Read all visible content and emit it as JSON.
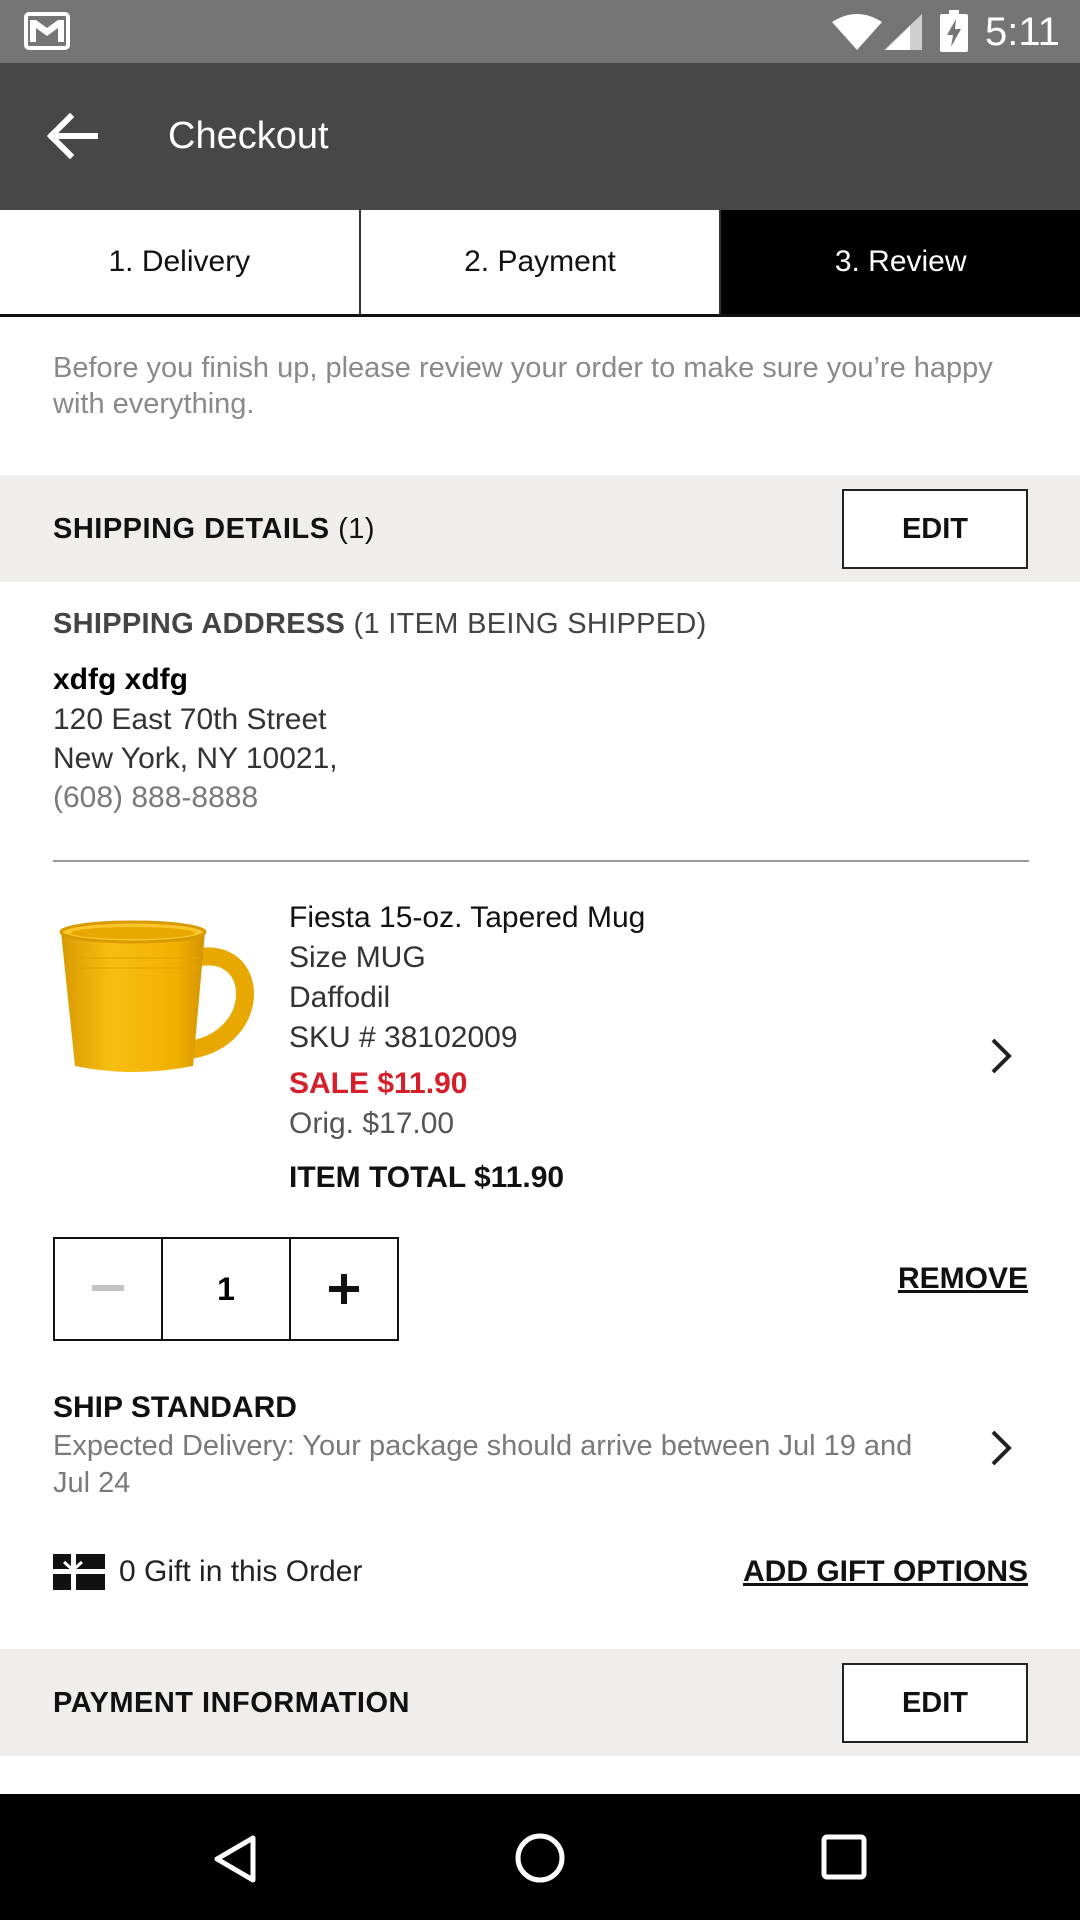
{
  "status_bar": {
    "time": "5:11"
  },
  "app_bar": {
    "title": "Checkout"
  },
  "tabs": [
    {
      "label": "1. Delivery"
    },
    {
      "label": "2. Payment"
    },
    {
      "label": "3. Review"
    }
  ],
  "intro_text": "Before you finish up, please review your order to make sure you’re happy with everything.",
  "shipping_details": {
    "title": "SHIPPING DETAILS",
    "count": "(1)",
    "edit_label": "EDIT"
  },
  "shipping_address": {
    "heading": "SHIPPING ADDRESS",
    "heading_note": "(1 ITEM BEING SHIPPED)",
    "name": "xdfg xdfg",
    "street": "120 East 70th Street",
    "city_line": "New York, NY 10021,",
    "phone": "(608) 888-8888"
  },
  "product": {
    "name": "Fiesta 15-oz. Tapered Mug",
    "size": "Size MUG",
    "color": "Daffodil",
    "sku": "SKU # 38102009",
    "sale_price": "SALE $11.90",
    "orig_price": "Orig. $17.00",
    "item_total": "ITEM TOTAL $11.90",
    "quantity": "1",
    "remove_label": "REMOVE"
  },
  "shipping_method": {
    "title": "SHIP STANDARD",
    "description": "Expected Delivery: Your package should arrive between Jul 19 and Jul 24"
  },
  "gift": {
    "count_text": "0 Gift in this Order",
    "add_label": "ADD GIFT OPTIONS"
  },
  "payment_information": {
    "title": "PAYMENT INFORMATION",
    "edit_label": "EDIT"
  },
  "colors": {
    "sale_red": "#d51f2b",
    "appbar": "#474747",
    "statusbar": "#757575",
    "section_bg": "#efeeec",
    "mug_yellow": "#f2b500"
  }
}
